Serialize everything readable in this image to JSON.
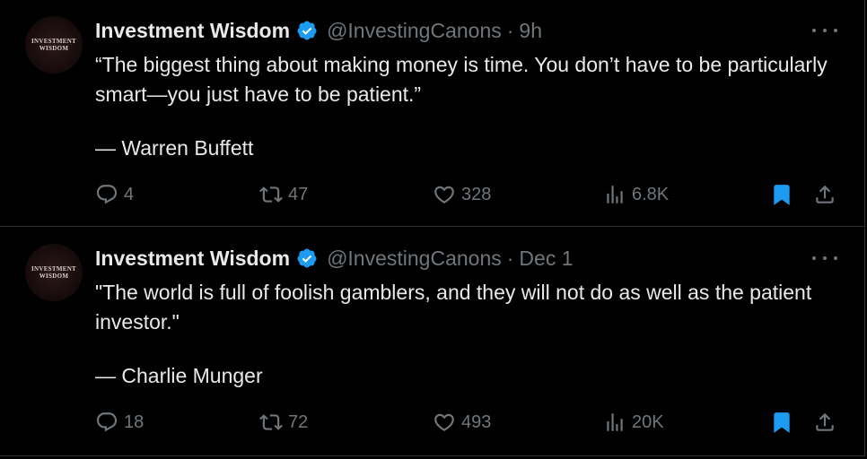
{
  "colors": {
    "background": "#000000",
    "text": "#e7e9ea",
    "muted": "#71767b",
    "verified": "#1d9bf0",
    "bookmark_active": "#1d9bf0",
    "divider": "#2f3336"
  },
  "tweets": [
    {
      "avatar_text": "INVESTMENT\nWISDOM",
      "name": "Investment Wisdom",
      "handle": "@InvestingCanons",
      "separator": "·",
      "time": "9h",
      "text": "“The biggest thing about making money is time. You don’t have to be particularly smart—you just have to be patient.”",
      "attribution": "— Warren Buffett",
      "replies": "4",
      "retweets": "47",
      "likes": "328",
      "views": "6.8K",
      "bookmarked": true
    },
    {
      "avatar_text": "INVESTMENT\nWISDOM",
      "name": "Investment Wisdom",
      "handle": "@InvestingCanons",
      "separator": "·",
      "time": "Dec 1",
      "text": "\"The world is full of foolish gamblers, and they will not do as well as the patient investor.\"",
      "attribution": "— Charlie Munger",
      "replies": "18",
      "retweets": "72",
      "likes": "493",
      "views": "20K",
      "bookmarked": true
    }
  ],
  "icons": {
    "verified": "verified-badge-icon",
    "more": "more-horizontal-icon",
    "reply": "reply-icon",
    "retweet": "retweet-icon",
    "like": "heart-icon",
    "views": "views-chart-icon",
    "bookmark": "bookmark-icon",
    "share": "share-icon"
  }
}
